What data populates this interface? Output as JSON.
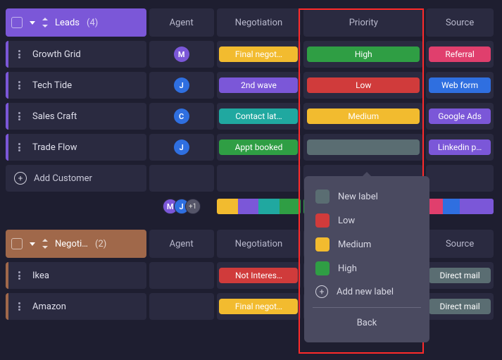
{
  "columns": {
    "agent": "Agent",
    "negotiation": "Negotiation",
    "priority": "Priority",
    "source": "Source"
  },
  "groups": [
    {
      "id": "leads",
      "name": "Leads",
      "count": "(4)",
      "accent": "#7b57d8",
      "rows": [
        {
          "name": "Growth Grid",
          "agent": {
            "initial": "M",
            "color": "#7b57d8"
          },
          "negotiation": {
            "label": "Final negot…",
            "color": "#f2bb2f"
          },
          "priority": {
            "label": "High",
            "color": "#2f9e44"
          },
          "source": {
            "label": "Referral",
            "color": "#e03f6d"
          }
        },
        {
          "name": "Tech Tide",
          "agent": {
            "initial": "J",
            "color": "#2f6fe0"
          },
          "negotiation": {
            "label": "2nd wave",
            "color": "#7b57d8"
          },
          "priority": {
            "label": "Low",
            "color": "#d03b3b"
          },
          "source": {
            "label": "Web form",
            "color": "#2f6fe0"
          }
        },
        {
          "name": "Sales Craft",
          "agent": {
            "initial": "C",
            "color": "#2f6fe0"
          },
          "negotiation": {
            "label": "Contact lat…",
            "color": "#20a8a0"
          },
          "priority": {
            "label": "Medium",
            "color": "#f2bb2f"
          },
          "source": {
            "label": "Google Ads",
            "color": "#7b57d8"
          }
        },
        {
          "name": "Trade Flow",
          "agent": {
            "initial": "J",
            "color": "#2f6fe0"
          },
          "negotiation": {
            "label": "Appt booked",
            "color": "#2f9e44"
          },
          "priority": {
            "label": "",
            "color": "#5a6d72",
            "blank": true
          },
          "source": {
            "label": "Linkedin p…",
            "color": "#7b57d8"
          }
        }
      ],
      "summary": {
        "agents": [
          {
            "initial": "M",
            "color": "#7b57d8"
          },
          {
            "initial": "J",
            "color": "#2f6fe0"
          }
        ],
        "extra": "+1",
        "neg_colors": [
          "#f2bb2f",
          "#7b57d8",
          "#20a8a0",
          "#2f9e44"
        ],
        "prio_colors": [
          "#2f9e44",
          "#d03b3b",
          "#f2bb2f",
          "#5a6d72"
        ],
        "src_colors": [
          "#e03f6d",
          "#2f6fe0",
          "#7b57d8",
          "#7b57d8"
        ]
      }
    },
    {
      "id": "negotiation",
      "name": "Negoti…",
      "count": "(2)",
      "accent": "#a0684a",
      "rows": [
        {
          "name": "Ikea",
          "agent": null,
          "negotiation": {
            "label": "Not Interes…",
            "color": "#d03b3b"
          },
          "priority": null,
          "source": {
            "label": "Direct mail",
            "color": "#5a6d72"
          }
        },
        {
          "name": "Amazon",
          "agent": null,
          "negotiation": {
            "label": "Final negot…",
            "color": "#f2bb2f"
          },
          "priority": null,
          "source": {
            "label": "Direct mail",
            "color": "#5a6d72"
          }
        }
      ]
    }
  ],
  "add_customer": "Add Customer",
  "dropdown": {
    "items": [
      {
        "label": "New label",
        "color": "#5a6d72"
      },
      {
        "label": "Low",
        "color": "#d03b3b"
      },
      {
        "label": "Medium",
        "color": "#f2bb2f"
      },
      {
        "label": "High",
        "color": "#2f9e44"
      }
    ],
    "add_new": "Add new label",
    "back": "Back"
  }
}
